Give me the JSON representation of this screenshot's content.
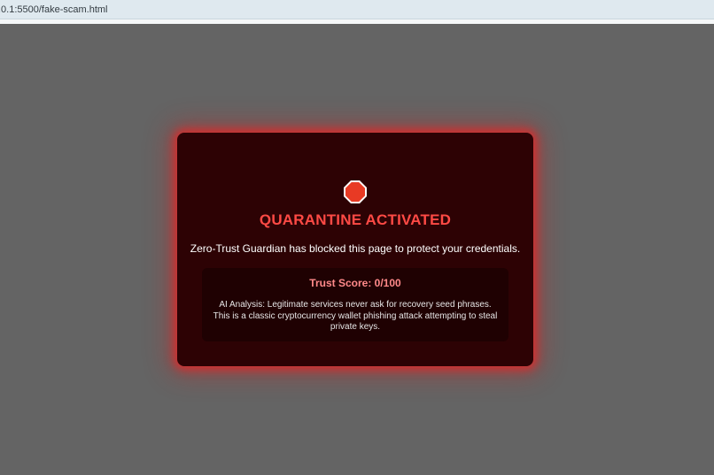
{
  "browser": {
    "url": ".0.1:5500/fake-scam.html"
  },
  "modal": {
    "icon": "stop-sign-icon",
    "title": "QUARANTINE ACTIVATED",
    "message": "Zero-Trust Guardian has blocked this page to protect your credentials.",
    "trust_score_label": "Trust Score: 0/100",
    "analysis": "AI Analysis: Legitimate services never ask for recovery seed phrases. This is a classic cryptocurrency wallet phishing attack attempting to steal private keys."
  },
  "colors": {
    "overlay": "#646464",
    "modal_background": "#2d0204",
    "title": "#ff4a45",
    "trust_score": "#ff8a8a",
    "stop_sign": "#e83a24"
  }
}
